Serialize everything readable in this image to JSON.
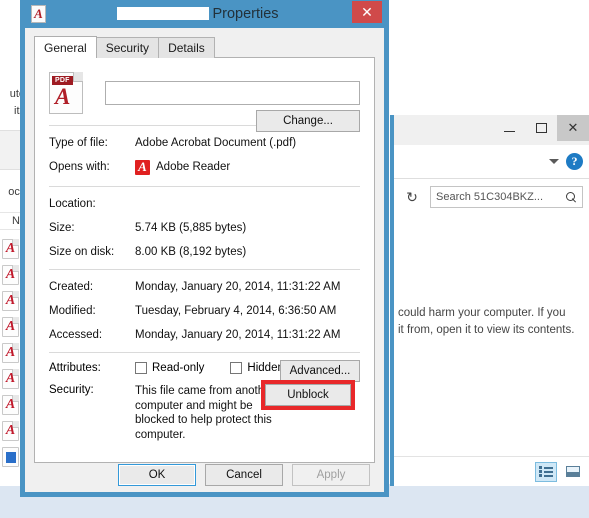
{
  "explorer_left": {
    "partial_text_lines": [
      "ute",
      "its"
    ],
    "partial_group": "ocu",
    "partial_column_header": "Na",
    "file_icons": [
      "pdf",
      "pdf",
      "pdf",
      "pdf",
      "pdf",
      "pdf",
      "pdf",
      "pdf",
      "doc"
    ]
  },
  "explorer_right": {
    "window_controls": {
      "minimize": "–",
      "maximize": "□",
      "close": "✕"
    },
    "ribbon": {
      "chevron": "chevron-down-icon",
      "help": "?"
    },
    "address_bar": {
      "refresh_glyph": "↻",
      "search_value": "Search 51C304BKZ...",
      "search_icon": "magnifier-icon"
    },
    "body_lines": [
      "could harm your computer. If you",
      "it from, open it to view its contents."
    ],
    "status_bar": {
      "details_view_label": "Details view",
      "icons_view_label": "Large icons view"
    }
  },
  "dialog": {
    "title_suffix": "Properties",
    "title_redacted": true,
    "close_label": "✕",
    "tabs": [
      {
        "label": "General",
        "active": true
      },
      {
        "label": "Security",
        "active": false
      },
      {
        "label": "Details",
        "active": false
      }
    ],
    "file_icon": {
      "badge": "PDF",
      "glyph": "acrobat-swirl"
    },
    "filename_value": "",
    "filename_placeholder": "",
    "fields": [
      {
        "label": "Type of file:",
        "value": "Adobe Acrobat Document (.pdf)"
      },
      {
        "label": "Opens with:",
        "value": "Adobe Reader"
      },
      {
        "label": "Location:",
        "value": ""
      },
      {
        "label": "Size:",
        "value": "5.74 KB (5,885 bytes)"
      },
      {
        "label": "Size on disk:",
        "value": "8.00 KB (8,192 bytes)"
      },
      {
        "label": "Created:",
        "value": "Monday, January 20, 2014, 11:31:22 AM"
      },
      {
        "label": "Modified:",
        "value": "Tuesday, February 4, 2014, 6:36:50 AM"
      },
      {
        "label": "Accessed:",
        "value": "Monday, January 20, 2014, 11:31:22 AM"
      }
    ],
    "change_button": "Change...",
    "attributes": {
      "label": "Attributes:",
      "read_only": {
        "label": "Read-only",
        "checked": false
      },
      "hidden": {
        "label": "Hidden",
        "checked": false
      },
      "advanced_button": "Advanced..."
    },
    "security": {
      "label": "Security:",
      "text": "This file came from another computer and might be blocked to help protect this computer.",
      "unblock_button": "Unblock",
      "highlight_color": "#e8282a"
    },
    "footer": {
      "ok": "OK",
      "cancel": "Cancel",
      "apply": "Apply",
      "apply_disabled": true
    }
  }
}
